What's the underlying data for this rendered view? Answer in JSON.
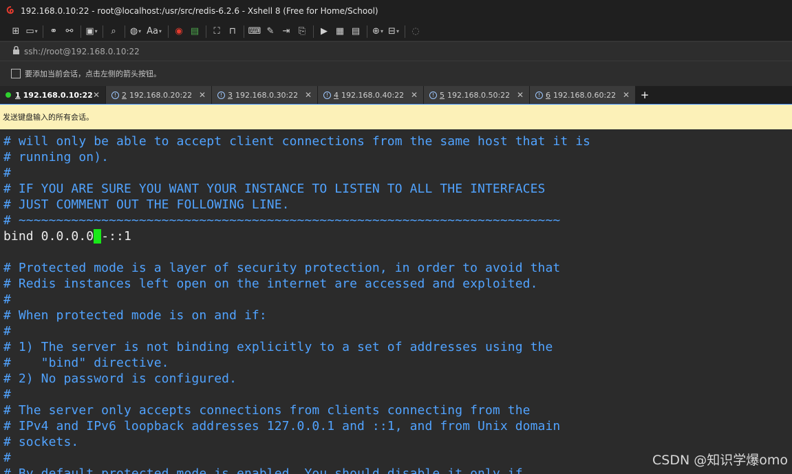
{
  "window": {
    "title": "192.168.0.10:22 - root@localhost:/usr/src/redis-6.2.6 - Xshell 8 (Free for Home/School)"
  },
  "address": {
    "url": "ssh://root@192.168.0.10:22"
  },
  "session_hint": "要添加当前会话，点击左侧的箭头按钮。",
  "tabs": [
    {
      "num": "1",
      "label": "192.168.0.10:22"
    },
    {
      "num": "2",
      "label": "192.168.0.20:22"
    },
    {
      "num": "3",
      "label": "192.168.0.30:22"
    },
    {
      "num": "4",
      "label": "192.168.0.40:22"
    },
    {
      "num": "5",
      "label": "192.168.0.50:22"
    },
    {
      "num": "6",
      "label": "192.168.0.60:22"
    }
  ],
  "tab_close": "✕",
  "tab_add": "+",
  "notice": "发送键盘输入的所有会话。",
  "terminal": {
    "lines": [
      "# will only be able to accept client connections from the same host that it is",
      "# running on).",
      "#",
      "# IF YOU ARE SURE YOU WANT YOUR INSTANCE TO LISTEN TO ALL THE INTERFACES",
      "# JUST COMMENT OUT THE FOLLOWING LINE.",
      "# ~~~~~~~~~~~~~~~~~~~~~~~~~~~~~~~~~~~~~~~~~~~~~~~~~~~~~~~~~~~~~~~~~~~~~~~~",
      "",
      "",
      "# Protected mode is a layer of security protection, in order to avoid that",
      "# Redis instances left open on the internet are accessed and exploited.",
      "#",
      "# When protected mode is on and if:",
      "#",
      "# 1) The server is not binding explicitly to a set of addresses using the",
      "#    \"bind\" directive.",
      "# 2) No password is configured.",
      "#",
      "# The server only accepts connections from clients connecting from the",
      "# IPv4 and IPv6 loopback addresses 127.0.0.1 and ::1, and from Unix domain",
      "# sockets.",
      "#",
      "# By default protected mode is enabled. You should disable it only if"
    ],
    "bind_before": "bind 0.0.0.0",
    "bind_cursor": " ",
    "bind_after": "-::1"
  },
  "watermark": "CSDN @知识学爆omo",
  "colors": {
    "comment": "#51a3ff",
    "background": "#2b2b2b",
    "cursor": "#18e818",
    "notice_bg": "#fcf1b8",
    "active_dot": "#2fd12f"
  },
  "icons": {
    "app_logo": "xshell-swirl-icon",
    "lock": "lock-icon",
    "info": "info-circle-icon"
  }
}
